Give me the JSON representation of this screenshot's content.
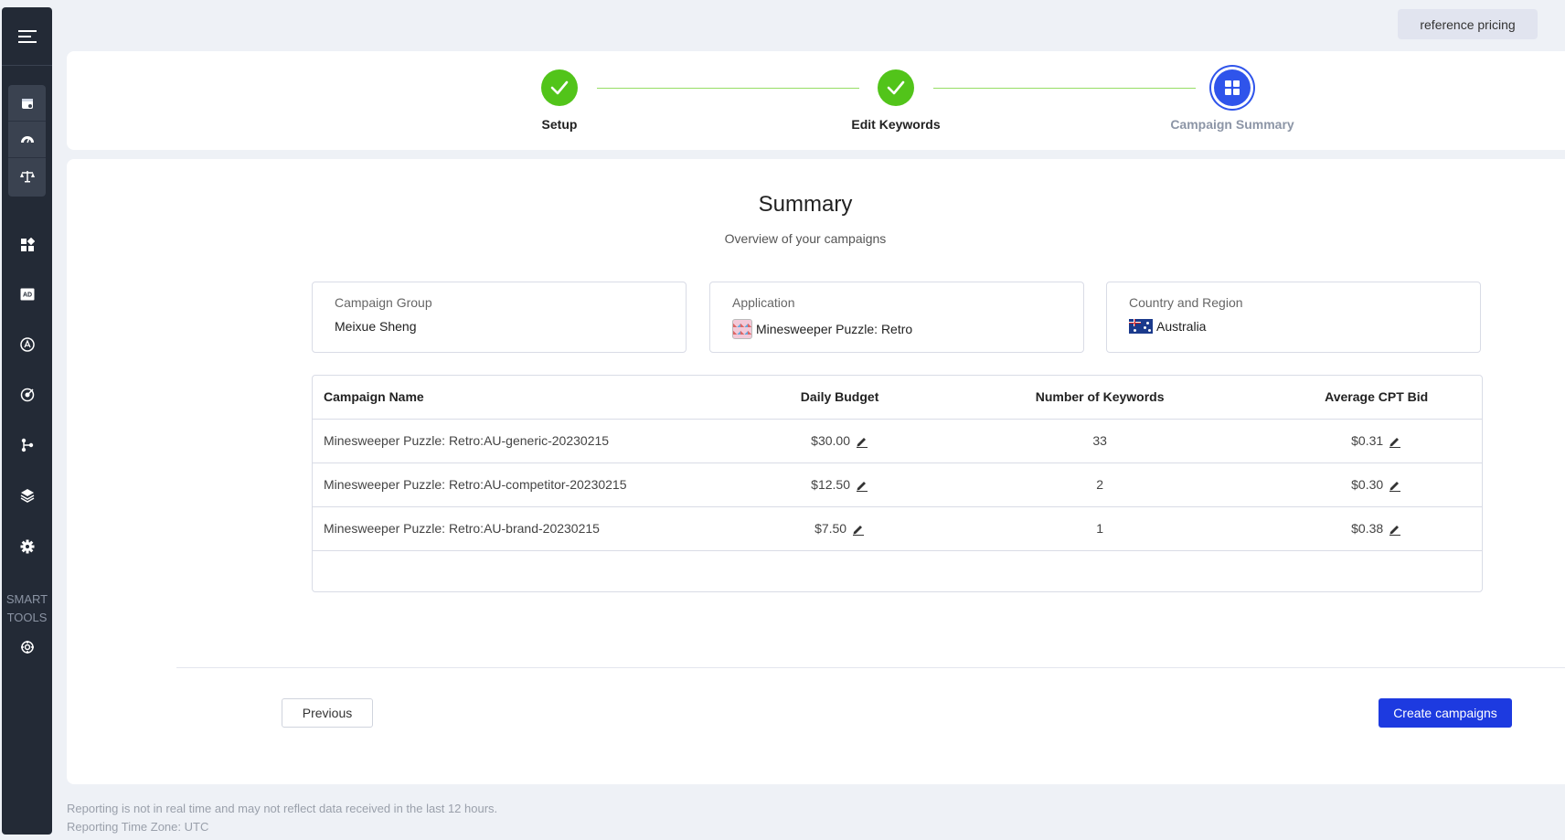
{
  "header": {
    "reference_pricing": "reference pricing"
  },
  "sidebar": {
    "smart_tools_line1": "SMART",
    "smart_tools_line2": "TOOLS"
  },
  "stepper": {
    "steps": [
      {
        "label": "Setup",
        "state": "done"
      },
      {
        "label": "Edit Keywords",
        "state": "done"
      },
      {
        "label": "Campaign Summary",
        "state": "active"
      }
    ]
  },
  "summary": {
    "title": "Summary",
    "subtitle": "Overview of your campaigns",
    "campaign_group": {
      "label": "Campaign Group",
      "value": "Meixue Sheng"
    },
    "application": {
      "label": "Application",
      "value": "Minesweeper Puzzle: Retro"
    },
    "country": {
      "label": "Country and Region",
      "value": "Australia"
    }
  },
  "table": {
    "headers": [
      "Campaign Name",
      "Daily Budget",
      "Number of Keywords",
      "Average CPT Bid"
    ],
    "rows": [
      {
        "name": "Minesweeper Puzzle: Retro:AU-generic-20230215",
        "budget": "$30.00",
        "keywords": "33",
        "cpt": "$0.31"
      },
      {
        "name": "Minesweeper Puzzle: Retro:AU-competitor-20230215",
        "budget": "$12.50",
        "keywords": "2",
        "cpt": "$0.30"
      },
      {
        "name": "Minesweeper Puzzle: Retro:AU-brand-20230215",
        "budget": "$7.50",
        "keywords": "1",
        "cpt": "$0.38"
      }
    ]
  },
  "actions": {
    "previous": "Previous",
    "create": "Create campaigns"
  },
  "footer": {
    "line1": "Reporting is not in real time and may not reflect data received in the last 12 hours.",
    "line2": "Reporting Time Zone: UTC"
  },
  "colors": {
    "accent": "#1d3ae0",
    "success": "#52c41a",
    "sidebar": "#232a36"
  }
}
